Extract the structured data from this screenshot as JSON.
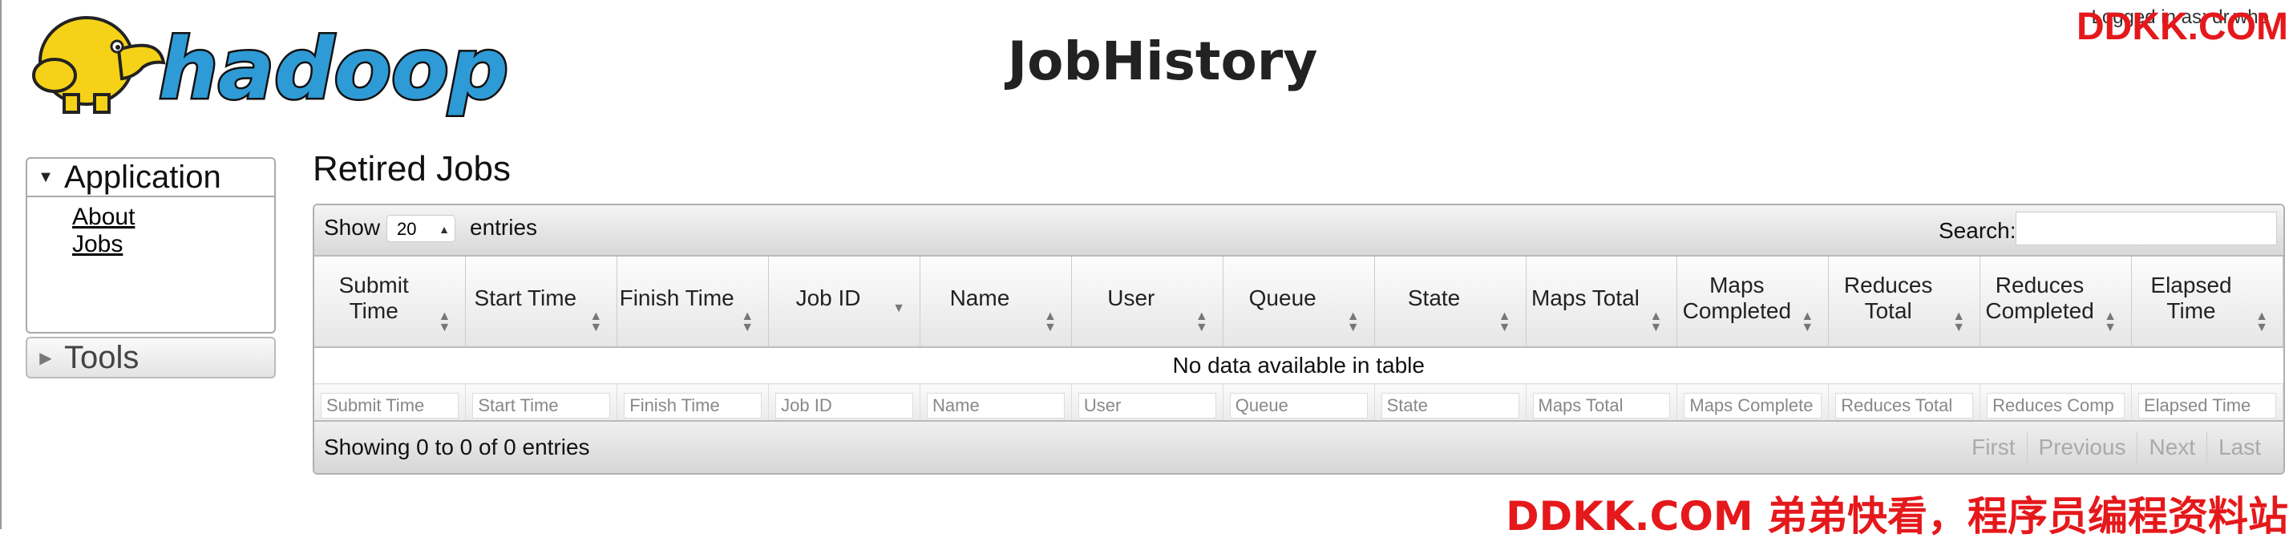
{
  "header": {
    "title": "JobHistory",
    "logo_alt": "hadoop",
    "logged_in": "Logged in as: dr.who"
  },
  "watermark": {
    "top": "DDKK.COM",
    "bottom": "DDKK.COM 弟弟快看，程序员编程资料站"
  },
  "nav": {
    "application": {
      "label": "Application",
      "links": [
        "About",
        "Jobs"
      ]
    },
    "tools": {
      "label": "Tools"
    }
  },
  "main": {
    "section_title": "Retired Jobs",
    "show_label": "Show",
    "page_length": "20",
    "entries_label": "entries",
    "search_label": "Search:",
    "columns": [
      "Submit Time",
      "Start Time",
      "Finish Time",
      "Job ID",
      "Name",
      "User",
      "Queue",
      "State",
      "Maps Total",
      "Maps Completed",
      "Reduces Total",
      "Reduces Completed",
      "Elapsed Time"
    ],
    "empty_message": "No data available in table",
    "filters": [
      "Submit Time",
      "Start Time",
      "Finish Time",
      "Job ID",
      "Name",
      "User",
      "Queue",
      "State",
      "Maps Total",
      "Maps Complete",
      "Reduces Total",
      "Reduces Comp",
      "Elapsed Time"
    ],
    "info": "Showing 0 to 0 of 0 entries",
    "pager": [
      "First",
      "Previous",
      "Next",
      "Last"
    ]
  },
  "colors": {
    "watermark": "#e5181b",
    "logo_blue": "#2e9bd6",
    "logo_yellow": "#f5d218"
  }
}
